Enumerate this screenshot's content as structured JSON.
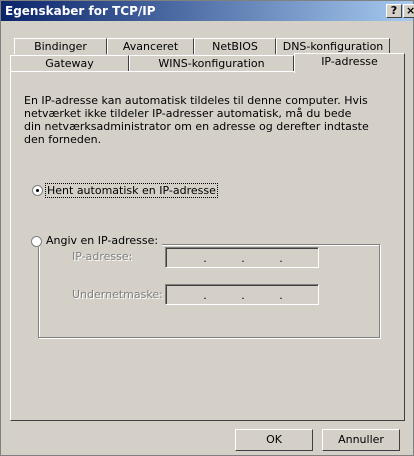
{
  "window": {
    "title": "Egenskaber for TCP/IP",
    "help_glyph": "?",
    "close_glyph": "×"
  },
  "tabs": {
    "row1": [
      "Bindinger",
      "Avanceret",
      "NetBIOS",
      "DNS-konfiguration"
    ],
    "row2": [
      "Gateway",
      "WINS-konfiguration",
      "IP-adresse"
    ],
    "active": "IP-adresse"
  },
  "panel": {
    "description": "En IP-adresse kan automatisk tildeles til denne computer. Hvis netværket ikke tildeler IP-adresser automatisk, må du bede din netværksadministrator om en adresse og derefter indtaste den forneden.",
    "radio_auto": {
      "label": "Hent automatisk en IP-adresse",
      "checked": true
    },
    "radio_manual": {
      "label": "Angiv en IP-adresse:",
      "checked": false
    },
    "ip_label": "IP-adresse:",
    "mask_label": "Undernetmaske:",
    "ip_separator": "."
  },
  "buttons": {
    "ok": "OK",
    "cancel": "Annuller"
  }
}
